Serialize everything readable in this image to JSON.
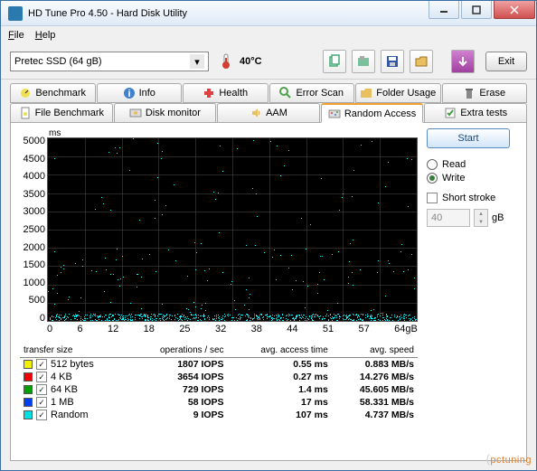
{
  "window": {
    "title": "HD Tune Pro 4.50 - Hard Disk Utility"
  },
  "menu": {
    "file": "File",
    "help": "Help"
  },
  "toolbar": {
    "drive": "Pretec SSD (64 gB)",
    "temp": "40°C",
    "exit": "Exit"
  },
  "tabs_top": {
    "benchmark": "Benchmark",
    "info": "Info",
    "health": "Health",
    "error_scan": "Error Scan",
    "folder_usage": "Folder Usage",
    "erase": "Erase"
  },
  "tabs_bottom": {
    "file_benchmark": "File Benchmark",
    "disk_monitor": "Disk monitor",
    "aam": "AAM",
    "random_access": "Random Access",
    "extra_tests": "Extra tests"
  },
  "controls": {
    "start": "Start",
    "read": "Read",
    "write": "Write",
    "short_stroke": "Short stroke",
    "stroke_val": "40",
    "stroke_unit": "gB"
  },
  "chart_data": {
    "type": "scatter",
    "ylabel": "ms",
    "ylim": [
      0,
      5000
    ],
    "yticks": [
      0,
      500,
      1000,
      1500,
      2000,
      2500,
      3000,
      3500,
      4000,
      4500,
      5000
    ],
    "xlim": [
      0,
      64
    ],
    "xlabel_unit": "64gB",
    "xticks": [
      0,
      6,
      12,
      18,
      25,
      32,
      38,
      44,
      51,
      57
    ]
  },
  "results": {
    "headers": {
      "transfer_size": "transfer size",
      "ops": "operations / sec",
      "access": "avg. access time",
      "speed": "avg. speed"
    },
    "rows": [
      {
        "color": "#f0f000",
        "label": "512 bytes",
        "iops": "1807 IOPS",
        "access": "0.55 ms",
        "speed": "0.883 MB/s"
      },
      {
        "color": "#f00000",
        "label": "4 KB",
        "iops": "3654 IOPS",
        "access": "0.27 ms",
        "speed": "14.276 MB/s"
      },
      {
        "color": "#00a000",
        "label": "64 KB",
        "iops": "729 IOPS",
        "access": "1.4 ms",
        "speed": "45.605 MB/s"
      },
      {
        "color": "#0040f0",
        "label": "1 MB",
        "iops": "58 IOPS",
        "access": "17 ms",
        "speed": "58.331 MB/s"
      },
      {
        "color": "#00e0e0",
        "label": "Random",
        "iops": "9 IOPS",
        "access": "107 ms",
        "speed": "4.737 MB/s"
      }
    ]
  },
  "watermark": "pctuning"
}
